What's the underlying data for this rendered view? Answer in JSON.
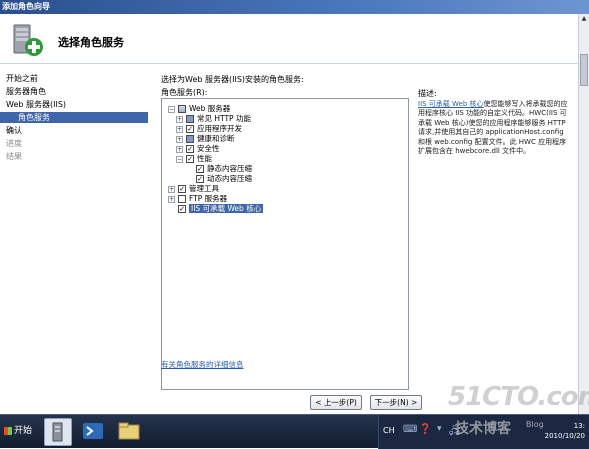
{
  "window": {
    "title": "添加角色向导"
  },
  "header": {
    "title": "选择角色服务",
    "icon": "add-roles-wizard-icon"
  },
  "sidebar": {
    "items": [
      {
        "label": "开始之前",
        "state": "normal"
      },
      {
        "label": "服务器角色",
        "state": "normal"
      },
      {
        "label": "Web 服务器(IIS)",
        "state": "normal"
      },
      {
        "label": "角色服务",
        "state": "selected"
      },
      {
        "label": "确认",
        "state": "normal"
      },
      {
        "label": "进度",
        "state": "dimmed"
      },
      {
        "label": "结果",
        "state": "dimmed"
      }
    ]
  },
  "main": {
    "section_label": "选择为Web 服务器(IIS)安装的角色服务:",
    "role_label": "角色服务(R):",
    "tree": [
      {
        "label": "Web 服务器",
        "level": 0,
        "expander": "-",
        "check": "mixed"
      },
      {
        "label": "常见 HTTP 功能",
        "level": 1,
        "expander": "+",
        "check": "partial"
      },
      {
        "label": "应用程序开发",
        "level": 1,
        "expander": "+",
        "check": "checked"
      },
      {
        "label": "健康和诊断",
        "level": 1,
        "expander": "+",
        "check": "partial"
      },
      {
        "label": "安全性",
        "level": 1,
        "expander": "+",
        "check": "checked"
      },
      {
        "label": "性能",
        "level": 1,
        "expander": "-",
        "check": "checked"
      },
      {
        "label": "静态内容压缩",
        "level": 2,
        "expander": "",
        "check": "checked"
      },
      {
        "label": "动态内容压缩",
        "level": 2,
        "expander": "",
        "check": "checked"
      },
      {
        "label": "管理工具",
        "level": 0,
        "expander": "+",
        "check": "checked"
      },
      {
        "label": "FTP 服务器",
        "level": 0,
        "expander": "+",
        "check": "unchecked"
      },
      {
        "label": "IIS 可承载 Web 核心",
        "level": 0,
        "expander": "",
        "check": "checked",
        "highlighted": true
      }
    ],
    "more_info_link": "有关角色服务的详细信息",
    "description": {
      "label": "描述:",
      "link": "IIS 可承载 Web 核心",
      "text": "使您能够写入将承载您的应用程序核心 IIS 功能的自定义代码。HWC(IIS 可承载 Web 核心)使您的应用程序能够服务 HTTP 请求,并使用其自己的 applicationHost.config 和根 web.config 配置文件。此 HWC 应用程序扩展包含在 hwebcore.dll 文件中。"
    }
  },
  "footer": {
    "prev_button": "< 上一步(P)",
    "next_button": "下一步(N) >"
  },
  "taskbar": {
    "start_label": "开始",
    "icons": [
      "server-manager-icon",
      "powershell-icon",
      "explorer-folder-icon"
    ],
    "tray_lang": "CH",
    "clock_time": "13:",
    "clock_date": "2010/10/20"
  },
  "watermark": {
    "site": "51CTO.com",
    "text": "技术博客",
    "blog": "Blog"
  },
  "colors": {
    "accent": "#3e66a8",
    "link": "#2b5fb0",
    "titlebar": "#2a4f8c"
  }
}
